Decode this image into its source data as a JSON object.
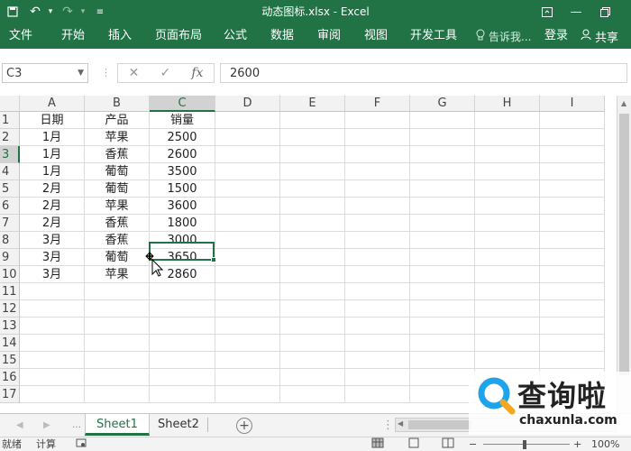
{
  "titlebar": {
    "title": "动态图标.xlsx - Excel",
    "undo_icon": "undo-icon",
    "redo_icon": "redo-icon",
    "save_icon": "save-icon"
  },
  "ribbon": {
    "tabs": [
      "文件",
      "开始",
      "插入",
      "页面布局",
      "公式",
      "数据",
      "审阅",
      "视图",
      "开发工具"
    ],
    "tell_me": "告诉我...",
    "login": "登录",
    "share": "共享"
  },
  "formula_bar": {
    "name_box": "C3",
    "fx_label": "fx",
    "formula": "2600"
  },
  "grid": {
    "columns": [
      "A",
      "B",
      "C",
      "D",
      "E",
      "F",
      "G",
      "H",
      "I"
    ],
    "selected_column": "C",
    "rows": [
      "1",
      "2",
      "3",
      "4",
      "5",
      "6",
      "7",
      "8",
      "9",
      "10",
      "11",
      "12",
      "13",
      "14",
      "15",
      "16",
      "17"
    ],
    "selected_row": "3",
    "data": [
      [
        "日期",
        "产品",
        "销量"
      ],
      [
        "1月",
        "苹果",
        "2500"
      ],
      [
        "1月",
        "香蕉",
        "2600"
      ],
      [
        "1月",
        "葡萄",
        "3500"
      ],
      [
        "2月",
        "葡萄",
        "1500"
      ],
      [
        "2月",
        "苹果",
        "3600"
      ],
      [
        "2月",
        "香蕉",
        "1800"
      ],
      [
        "3月",
        "香蕉",
        "3000"
      ],
      [
        "3月",
        "葡萄",
        "3650"
      ],
      [
        "3月",
        "苹果",
        "2860"
      ]
    ]
  },
  "sheets": {
    "tabs": [
      "Sheet1",
      "Sheet2"
    ],
    "active": "Sheet1"
  },
  "statusbar": {
    "ready": "就绪",
    "calc": "计算",
    "zoom": "100%"
  },
  "watermark": {
    "brand": "查询啦",
    "domain": "chaxunla.com"
  },
  "colors": {
    "excel_green": "#217346"
  }
}
